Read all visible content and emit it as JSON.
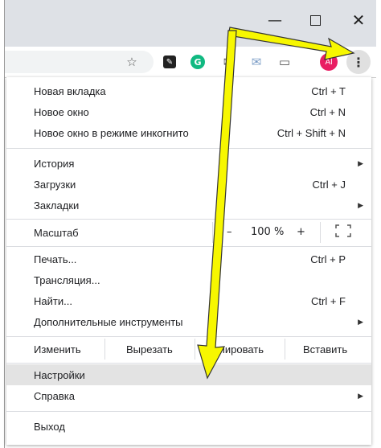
{
  "window": {
    "minimize_glyph": "—",
    "close_glyph": "✕"
  },
  "toolbar": {
    "star_icon": "☆",
    "avatar_text": "Al",
    "kebab_icon": "⋮"
  },
  "menu": {
    "new_tab": {
      "label": "Новая вкладка",
      "shortcut": "Ctrl + T"
    },
    "new_window": {
      "label": "Новое окно",
      "shortcut": "Ctrl + N"
    },
    "incognito": {
      "label": "Новое окно в режиме инкогнито",
      "shortcut": "Ctrl + Shift + N"
    },
    "history": {
      "label": "История"
    },
    "downloads": {
      "label": "Загрузки",
      "shortcut": "Ctrl + J"
    },
    "bookmarks": {
      "label": "Закладки"
    },
    "zoom": {
      "label": "Масштаб",
      "minus": "–",
      "value": "100 %",
      "plus": "+"
    },
    "print": {
      "label": "Печать...",
      "shortcut": "Ctrl + P"
    },
    "cast": {
      "label": "Трансляция..."
    },
    "find": {
      "label": "Найти...",
      "shortcut": "Ctrl + F"
    },
    "more_tools": {
      "label": "Дополнительные инструменты"
    },
    "edit": {
      "label": "Изменить",
      "cut": "Вырезать",
      "copy": "Копировать",
      "paste": "Вставить"
    },
    "settings": {
      "label": "Настройки"
    },
    "help": {
      "label": "Справка"
    },
    "exit": {
      "label": "Выход"
    }
  },
  "colors": {
    "annotation_arrow": "#f7f700",
    "highlight": "#e3e3e3"
  }
}
